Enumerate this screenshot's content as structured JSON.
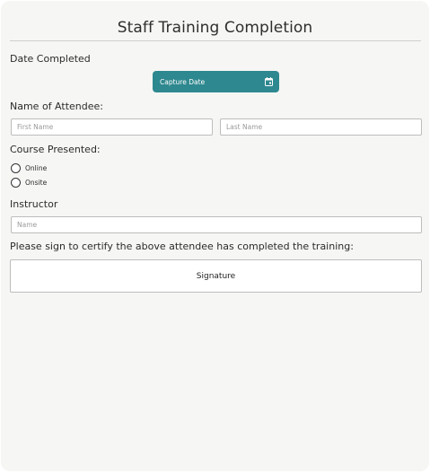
{
  "form": {
    "title": "Staff Training Completion",
    "date_label": "Date Completed",
    "capture_date_button": "Capture Date",
    "attendee_label": "Name of Attendee:",
    "first_name_placeholder": "First Name",
    "last_name_placeholder": "Last Name",
    "course_label": "Course Presented:",
    "course_options": [
      "Online",
      "Onsite"
    ],
    "instructor_label": "Instructor",
    "instructor_placeholder": "Name",
    "certify_text": "Please sign to certify the above attendee has completed the training:",
    "signature_label": "Signature"
  },
  "icons": {
    "calendar": "calendar-icon"
  },
  "colors": {
    "accent": "#2e888f",
    "background": "#f6f6f4",
    "border": "#bdbdbd"
  }
}
